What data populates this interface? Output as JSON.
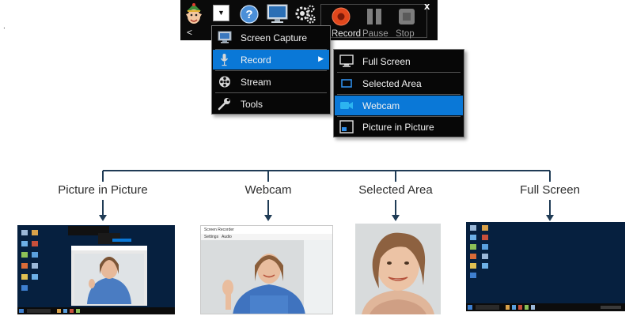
{
  "toolbar": {
    "back_label": "<",
    "dropdown_arrow": "▼",
    "close_label": "x",
    "record_label": "Record",
    "pause_label": "Pause",
    "stop_label": "Stop",
    "icons": [
      "elf-mascot-icon",
      "help-icon",
      "monitor-icon",
      "settings-gears-icon",
      "record-icon",
      "pause-icon",
      "stop-icon"
    ]
  },
  "main_menu": {
    "items": [
      {
        "label": "Screen Capture",
        "icon": "screen-capture-icon"
      },
      {
        "label": "Record",
        "icon": "microphone-icon",
        "has_submenu": true,
        "highlighted": true
      },
      {
        "label": "Stream",
        "icon": "stream-reel-icon"
      },
      {
        "label": "Tools",
        "icon": "wrench-icon"
      }
    ],
    "submenu_arrow": "▶"
  },
  "sub_menu": {
    "items": [
      {
        "label": "Full Screen",
        "icon": "full-screen-monitor-icon"
      },
      {
        "label": "Selected Area",
        "icon": "selected-area-icon"
      },
      {
        "label": "Webcam",
        "icon": "webcam-icon",
        "highlighted": true
      },
      {
        "label": "Picture in Picture",
        "icon": "picture-in-picture-icon"
      }
    ]
  },
  "diagram": {
    "labels": [
      "Picture in Picture",
      "Webcam",
      "Selected Area",
      "Full Screen"
    ]
  },
  "thumbnails": {
    "webcam_window": {
      "title": "Screen Recorder",
      "menu_items": [
        "Settings",
        "Audio"
      ]
    }
  },
  "colors": {
    "toolbar_bg": "#0a0a0a",
    "menu_highlight": "#0a78d7",
    "diagram_line": "#1f3b55",
    "desktop_bg": "#06203f",
    "record_red": "#e1471c"
  }
}
